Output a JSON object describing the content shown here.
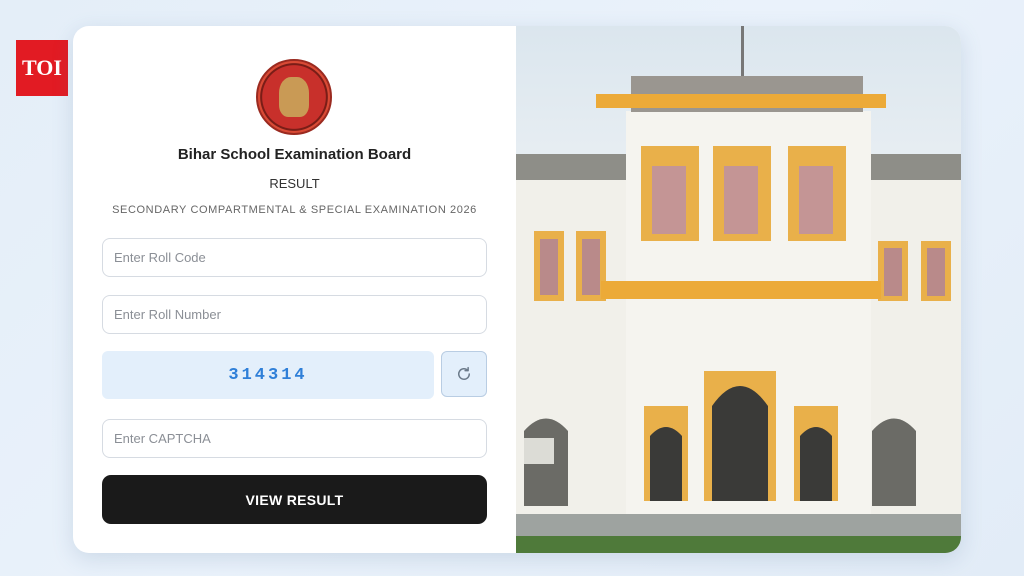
{
  "brand": {
    "logo_text": "TOI"
  },
  "form": {
    "board_name": "Bihar School Examination Board",
    "heading": "RESULT",
    "exam_name": "SECONDARY COMPARTMENTAL & SPECIAL EXAMINATION 2026",
    "roll_code_placeholder": "Enter Roll Code",
    "roll_number_placeholder": "Enter Roll Number",
    "captcha_value": "314314",
    "captcha_placeholder": "Enter CAPTCHA",
    "submit_label": "VIEW RESULT",
    "refresh_icon": "refresh-icon"
  },
  "colors": {
    "logo_bg": "#e21b23",
    "button_bg": "#1a1a1a",
    "captcha_bg": "#e3effb",
    "captcha_text": "#2f7fd8"
  }
}
